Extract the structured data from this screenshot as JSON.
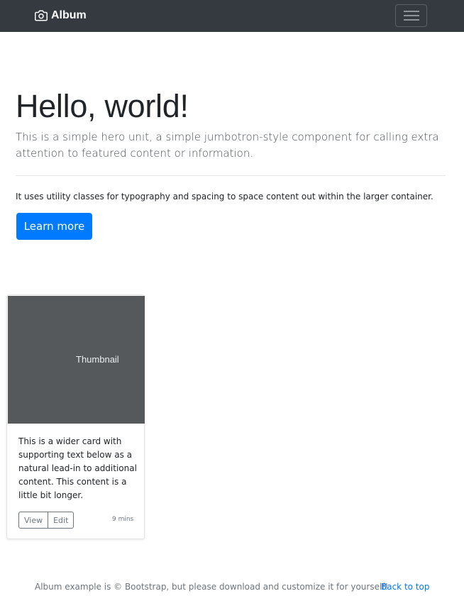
{
  "navbar": {
    "brand_icon": "camera-icon",
    "brand": "Album",
    "toggler_icon": "hamburger-menu-icon",
    "background": "#343a40"
  },
  "hero": {
    "title": "Hello, world!",
    "lead": "This is a simple hero unit, a simple jumbotron-style component for calling extra attention to featured content or information.",
    "body": "It uses utility classes for typography and spacing to space content out within the larger container.",
    "button": "Learn more",
    "button_color": "#007bff"
  },
  "cards": [
    {
      "thumbnail_label": "Thumbnail",
      "thumbnail_color": "#55595c",
      "text": "This is a wider card with supporting text below as a natural lead-in to additional content. This content is a little bit longer.",
      "view_button": "View",
      "edit_button": "Edit",
      "time": "9 mins"
    }
  ],
  "footer": {
    "text": "Album example is © Bootstrap, but please download and customize it for yourself!",
    "back_to_top": "Back to top"
  }
}
